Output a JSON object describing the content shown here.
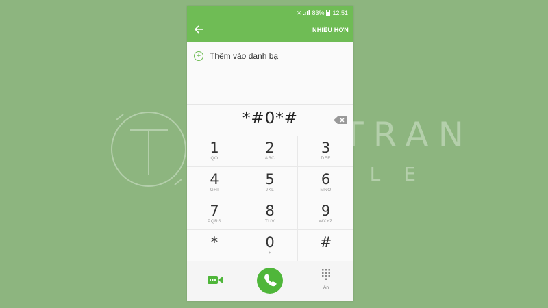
{
  "status_bar": {
    "battery": "83%",
    "time": "12:51"
  },
  "header": {
    "more_label": "NHIỀU HƠN"
  },
  "add_contact": {
    "label": "Thêm vào danh bạ"
  },
  "dialer": {
    "entered_number": "*#0*#"
  },
  "keypad": [
    {
      "digit": "1",
      "letters": "QO"
    },
    {
      "digit": "2",
      "letters": "ABC"
    },
    {
      "digit": "3",
      "letters": "DEF"
    },
    {
      "digit": "4",
      "letters": "GHI"
    },
    {
      "digit": "5",
      "letters": "JKL"
    },
    {
      "digit": "6",
      "letters": "MNO"
    },
    {
      "digit": "7",
      "letters": "PQRS"
    },
    {
      "digit": "8",
      "letters": "TUV"
    },
    {
      "digit": "9",
      "letters": "WXYZ"
    },
    {
      "digit": "*",
      "letters": ""
    },
    {
      "digit": "0",
      "letters": "+"
    },
    {
      "digit": "#",
      "letters": ""
    }
  ],
  "bottom": {
    "hide_label": "Ẩn"
  },
  "watermark": {
    "line1": "TIEN TRAN",
    "line2": "MOBILE"
  },
  "colors": {
    "accent": "#6fbc55",
    "call_button": "#4fb63a",
    "page_background": "#8db57f"
  },
  "icons": {
    "back": "arrow-left-icon",
    "add": "plus-circle-icon",
    "backspace": "backspace-icon",
    "video_call": "video-call-icon",
    "call": "phone-icon",
    "hide_keypad": "dialpad-icon"
  }
}
